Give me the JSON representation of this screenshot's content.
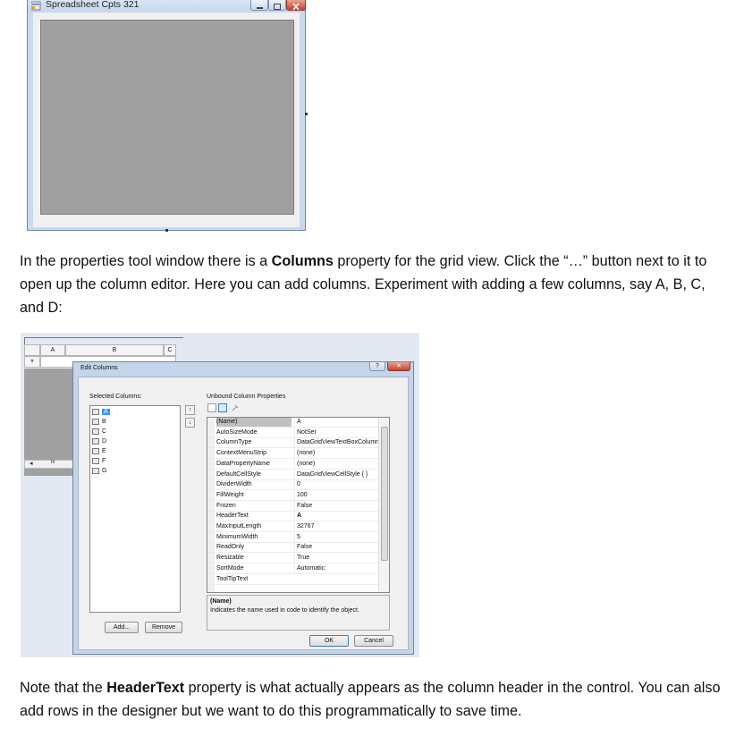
{
  "form": {
    "title": "Spreadsheet Cpts 321"
  },
  "paragraphs": {
    "p1_part1": "In the properties tool window there is a ",
    "p1_bold": "Columns",
    "p1_part2": " property for the grid view. Click the “…” button next to it to open up the column editor. Here you can add columns. Experiment with adding a few columns, say A, B, C, and D:",
    "p2_part1": "Note that the ",
    "p2_bold": "HeaderText",
    "p2_part2": " property is what actually appears as the column header in the control. You can also add rows in the designer but we want to do this programmatically to save time."
  },
  "background_grid": {
    "headers": [
      "A",
      "B",
      "C"
    ],
    "new_row_marker": "*",
    "scroll_left": "◂",
    "scroll_dots": "III"
  },
  "dialog": {
    "title": "Edit Columns",
    "help_label": "?",
    "close_label": "✕",
    "selected_columns_label": "Selected Columns:",
    "columns": [
      "A",
      "B",
      "C",
      "D",
      "E",
      "F",
      "G"
    ],
    "selected_index": 0,
    "move_up": "↑",
    "move_down": "↓",
    "add_button": "Add...",
    "remove_button": "Remove",
    "properties_label": "Unbound Column Properties",
    "properties": [
      {
        "name": "(Name)",
        "value": "A"
      },
      {
        "name": "AutoSizeMode",
        "value": "NotSet"
      },
      {
        "name": "ColumnType",
        "value": "DataGridViewTextBoxColumn"
      },
      {
        "name": "ContextMenuStrip",
        "value": "(none)"
      },
      {
        "name": "DataPropertyName",
        "value": "(none)"
      },
      {
        "name": "DefaultCellStyle",
        "value": "DataGridViewCellStyle { }"
      },
      {
        "name": "DividerWidth",
        "value": "0"
      },
      {
        "name": "FillWeight",
        "value": "100"
      },
      {
        "name": "Frozen",
        "value": "False"
      },
      {
        "name": "HeaderText",
        "value": "A"
      },
      {
        "name": "MaxInputLength",
        "value": "32767"
      },
      {
        "name": "MinimumWidth",
        "value": "5"
      },
      {
        "name": "ReadOnly",
        "value": "False"
      },
      {
        "name": "Resizable",
        "value": "True"
      },
      {
        "name": "SortMode",
        "value": "Automatic"
      },
      {
        "name": "ToolTipText",
        "value": ""
      }
    ],
    "description_title": "(Name)",
    "description_text": "Indicates the name used in code to identify the object.",
    "ok_button": "OK",
    "cancel_button": "Cancel"
  },
  "colors": {
    "selection": "#3399ff",
    "grid_gray": "#a0a0a0",
    "frame_blue": "#c4d5ea"
  }
}
